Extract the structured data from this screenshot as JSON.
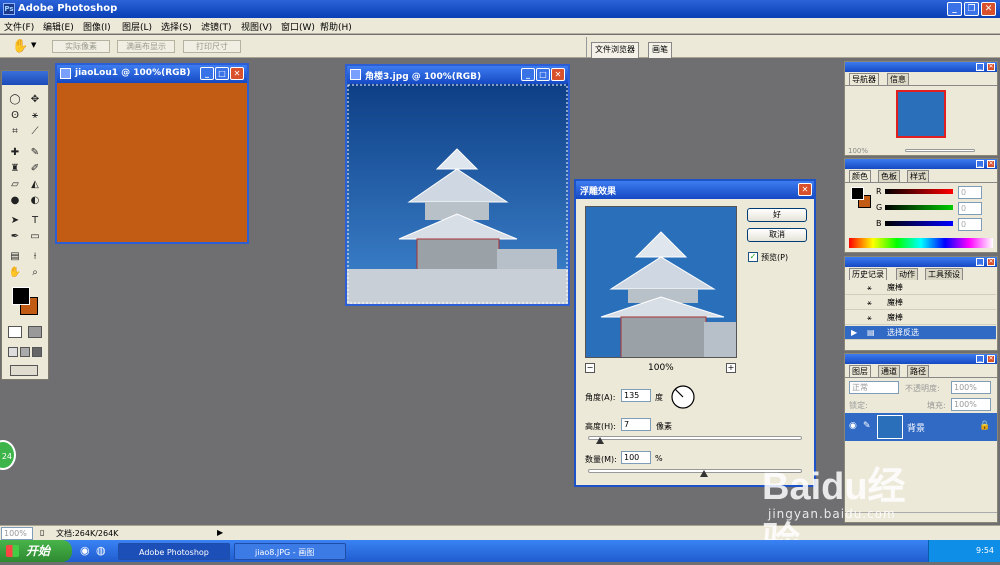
{
  "app": {
    "title": "Adobe Photoshop"
  },
  "menu": [
    "文件(F)",
    "编辑(E)",
    "图像(I)",
    "图层(L)",
    "选择(S)",
    "滤镜(T)",
    "视图(V)",
    "窗口(W)",
    "帮助(H)"
  ],
  "options": {
    "actual_pixels": "实际像素",
    "fit_screen": "满画布显示",
    "print_size": "打印尺寸"
  },
  "wells": {
    "file_browser": "文件浏览器",
    "brushes": "画笔"
  },
  "doc1": {
    "title": "jiaoLou1 @ 100%(RGB)",
    "fill": "#c25c14"
  },
  "doc2": {
    "title": "角楼3.jpg @ 100%(RGB)"
  },
  "dialog": {
    "title": "浮雕效果",
    "ok": "好",
    "cancel": "取消",
    "preview_label": "预览(P)",
    "preview_checked": true,
    "zoom": "100%",
    "angle_label": "角度(A):",
    "angle_value": "135",
    "angle_unit": "度",
    "height_label": "高度(H):",
    "height_value": "7",
    "height_unit": "像素",
    "amount_label": "数量(M):",
    "amount_value": "100",
    "amount_unit": "%"
  },
  "navigator": {
    "tab1": "导航器",
    "tab2": "信息",
    "zoom": "100%"
  },
  "color_panel": {
    "tab1": "颜色",
    "tab2": "色板",
    "tab3": "样式",
    "r": "R",
    "g": "G",
    "b": "B",
    "r_val": "0",
    "g_val": "0",
    "b_val": "0"
  },
  "history": {
    "tab1": "历史记录",
    "tab2": "动作",
    "tab3": "工具预设",
    "items": [
      "魔棒",
      "魔棒",
      "魔棒",
      "选择反选"
    ]
  },
  "layers": {
    "tab1": "图层",
    "tab2": "通道",
    "tab3": "路径",
    "mode": "正常",
    "opacity_label": "不透明度:",
    "opacity": "100%",
    "lock_label": "锁定:",
    "fill_label": "填充:",
    "fill": "100%",
    "layer_name": "背景"
  },
  "status": {
    "zoom": "100%",
    "doc": "文档:264K/264K"
  },
  "taskbar": {
    "start": "开始",
    "task1": "Adobe Photoshop",
    "task2": "jiao8.JPG - 画图",
    "time": "9:54"
  },
  "watermark": {
    "brand": "Baidu经验",
    "url": "jingyan.baidu.com"
  },
  "badge": "24"
}
